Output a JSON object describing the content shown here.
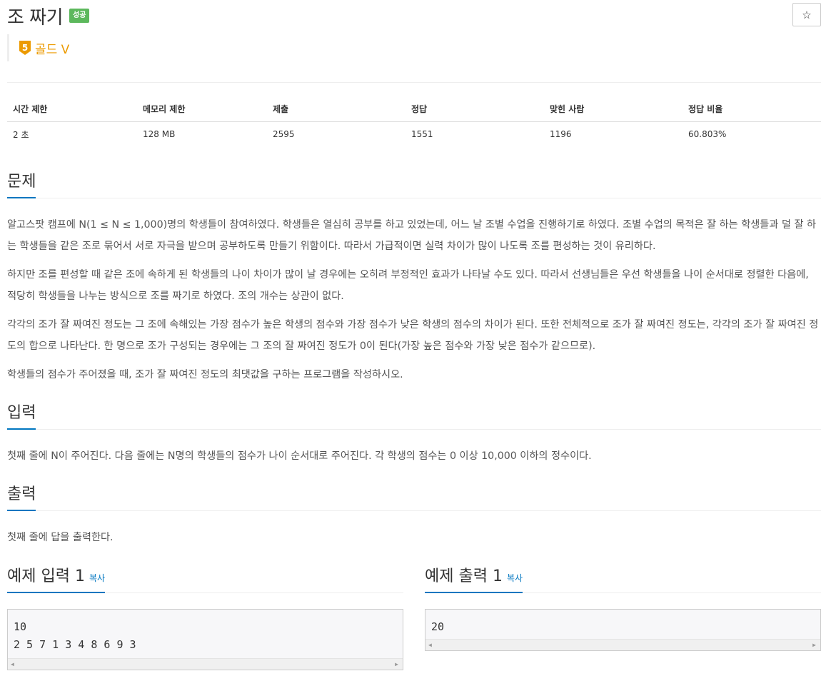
{
  "problem": {
    "title": "조 짜기",
    "badge": "성공",
    "star_icon": "☆",
    "tier_number": "5",
    "tier_label": "골드 V"
  },
  "info_table": {
    "headers": [
      "시간 제한",
      "메모리 제한",
      "제출",
      "정답",
      "맞힌 사람",
      "정답 비율"
    ],
    "values": [
      "2 초",
      "128 MB",
      "2595",
      "1551",
      "1196",
      "60.803%"
    ]
  },
  "sections": {
    "description_title": "문제",
    "description": [
      "알고스팟 캠프에 N(1 ≤ N ≤ 1,000)명의 학생들이 참여하였다. 학생들은 열심히 공부를 하고 있었는데, 어느 날 조별 수업을 진행하기로 하였다. 조별 수업의 목적은 잘 하는 학생들과 덜 잘 하는 학생들을 같은 조로 묶어서 서로 자극을 받으며 공부하도록 만들기 위함이다. 따라서 가급적이면 실력 차이가 많이 나도록 조를 편성하는 것이 유리하다.",
      "하지만 조를 편성할 때 같은 조에 속하게 된 학생들의 나이 차이가 많이 날 경우에는 오히려 부정적인 효과가 나타날 수도 있다. 따라서 선생님들은 우선 학생들을 나이 순서대로 정렬한 다음에, 적당히 학생들을 나누는 방식으로 조를 짜기로 하였다. 조의 개수는 상관이 없다.",
      "각각의 조가 잘 짜여진 정도는 그 조에 속해있는 가장 점수가 높은 학생의 점수와 가장 점수가 낮은 학생의 점수의 차이가 된다. 또한 전체적으로 조가 잘 짜여진 정도는, 각각의 조가 잘 짜여진 정도의 합으로 나타난다. 한 명으로 조가 구성되는 경우에는 그 조의 잘 짜여진 정도가 0이 된다(가장 높은 점수와 가장 낮은 점수가 같으므로).",
      "학생들의 점수가 주어졌을 때, 조가 잘 짜여진 정도의 최댓값을 구하는 프로그램을 작성하시오."
    ],
    "input_title": "입력",
    "input": "첫째 줄에 N이 주어진다. 다음 줄에는 N명의 학생들의 점수가 나이 순서대로 주어진다. 각 학생의 점수는 0 이상 10,000 이하의 정수이다.",
    "output_title": "출력",
    "output": "첫째 줄에 답을 출력한다."
  },
  "samples": {
    "input_title": "예제 입력 1",
    "output_title": "예제 출력 1",
    "copy_label": "복사",
    "input_lines": [
      "10",
      "2 5 7 1 3 4 8 6 9 3"
    ],
    "output_lines": [
      "20"
    ]
  }
}
